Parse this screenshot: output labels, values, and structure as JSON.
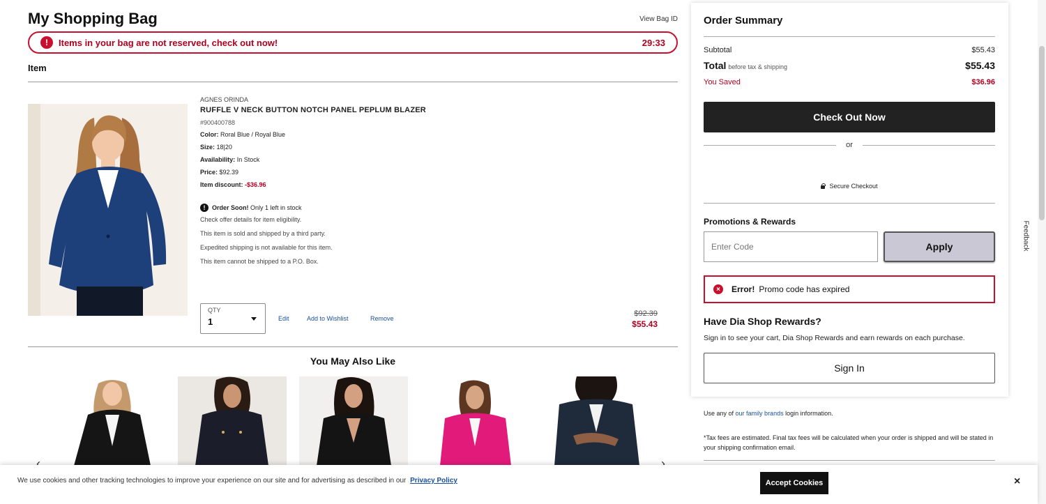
{
  "bag": {
    "title": "My Shopping Bag",
    "view_bag_id": "View Bag ID",
    "timer_message": "Items in your bag are not reserved, check out now!",
    "timer": "29:33",
    "item_header": "Item"
  },
  "product": {
    "brand": "AGNES ORINDA",
    "name": "RUFFLE V NECK BUTTON NOTCH PANEL PEPLUM BLAZER",
    "sku": "#900400788",
    "color_label": "Color:",
    "color_value": "Roral Blue / Royal Blue",
    "size_label": "Size:",
    "size_value": "18|20",
    "availability_label": "Availability:",
    "availability_value": "In Stock",
    "price_label": "Price:",
    "price_value": "$92.39",
    "discount_label": "Item discount:",
    "discount_value": "-$36.96",
    "order_soon_strong": "Order Soon!",
    "order_soon_text": "Only 1 left in stock",
    "notes": [
      "Check offer details for item eligibility.",
      "This item is sold and shipped by a third party.",
      "Expedited shipping is not available for this item.",
      "This item cannot be shipped to a P.O. Box."
    ],
    "qty_label": "QTY",
    "qty_value": "1",
    "edit": "Edit",
    "add_to_wishlist": "Add to Wishlist",
    "remove": "Remove",
    "old_price": "$92.39",
    "new_price": "$55.43"
  },
  "recommendations": {
    "title": "You May Also Like"
  },
  "summary": {
    "title": "Order Summary",
    "subtotal_label": "Subtotal",
    "subtotal_value": "$55.43",
    "total_label": "Total",
    "total_note": "before tax & shipping",
    "total_value": "$55.43",
    "saved_label": "You Saved",
    "saved_value": "$36.96",
    "checkout": "Check Out Now",
    "or": "or",
    "secure": "Secure Checkout",
    "promo_title": "Promotions & Rewards",
    "promo_placeholder": "Enter Code",
    "apply": "Apply",
    "error_strong": "Error!",
    "error_text": "Promo code has expired",
    "rewards_title": "Have Dia Shop Rewards?",
    "rewards_text": "Sign in to see your cart, Dia Shop Rewards and earn rewards on each purchase.",
    "sign_in": "Sign In"
  },
  "footer_notes": {
    "family_prefix": "Use any of",
    "family_link": "our family brands",
    "family_suffix": "login information.",
    "tax_note": "*Tax fees are estimated. Final tax fees will be calculated when your order is shipped and will be stated in your shipping confirmation email."
  },
  "feedback": "Feedback",
  "cookie": {
    "text": "We use cookies and other tracking technologies to improve your experience on our site and for advertising as described in our",
    "link": "Privacy Policy",
    "accept": "Accept Cookies",
    "close": "×"
  },
  "colors": {
    "accent_red": "#c8102e",
    "dark_button": "#222222",
    "link_blue": "#1a4f9c"
  }
}
